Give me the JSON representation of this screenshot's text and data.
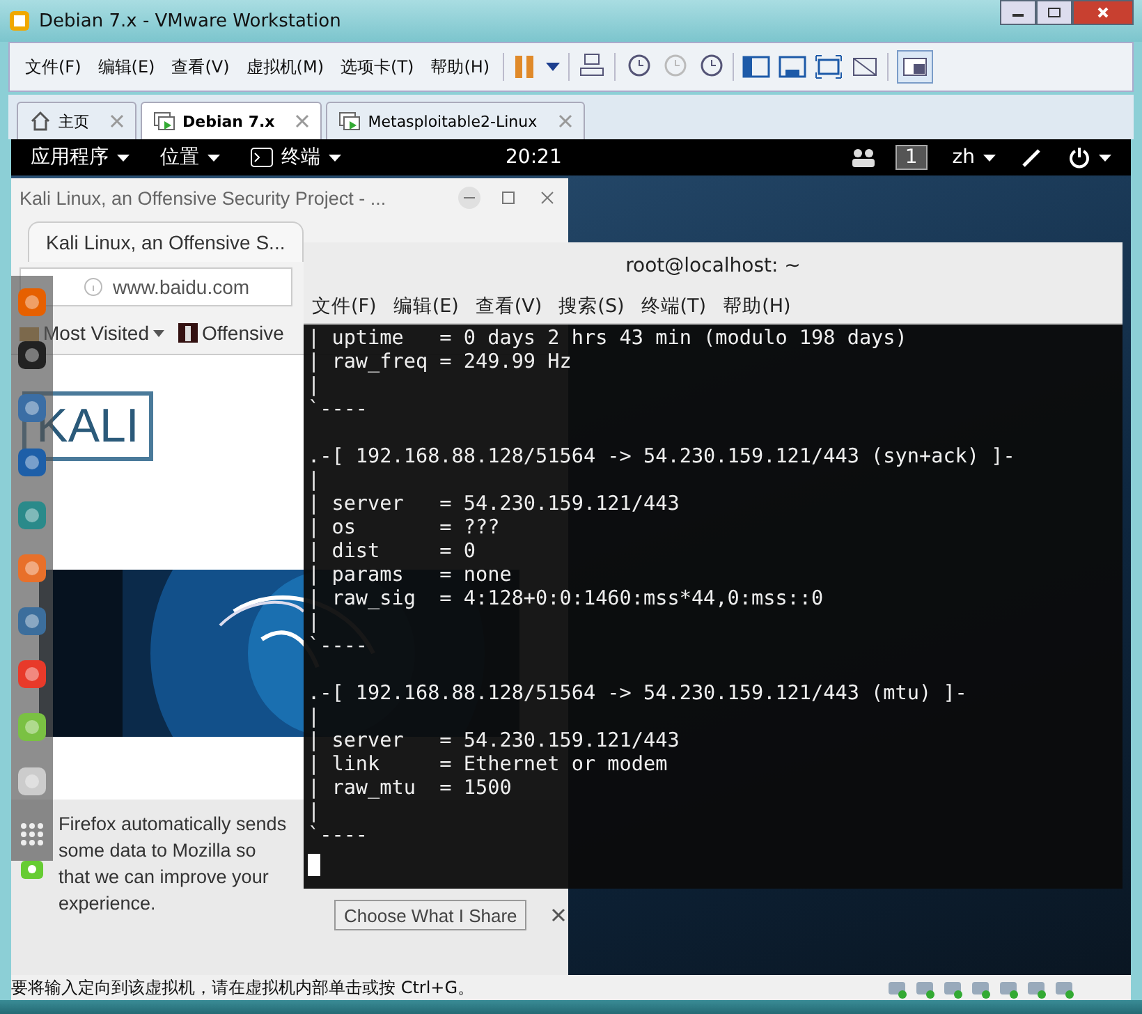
{
  "window": {
    "title": "Debian 7.x - VMware Workstation"
  },
  "menu": [
    "文件(F)",
    "编辑(E)",
    "查看(V)",
    "虚拟机(M)",
    "选项卡(T)",
    "帮助(H)"
  ],
  "tabs": [
    {
      "label": "主页",
      "selected": false,
      "kind": "home"
    },
    {
      "label": "Debian 7.x",
      "selected": true,
      "kind": "vm"
    },
    {
      "label": "Metasploitable2-Linux",
      "selected": false,
      "kind": "vm"
    }
  ],
  "guest": {
    "top_bar": {
      "menus": [
        "应用程序",
        "位置",
        "终端"
      ],
      "clock": "20:21",
      "workspace": "1",
      "input_method": "zh"
    },
    "firefox": {
      "title": "Kali Linux, an Offensive Security Project - ...",
      "tab": "Kali Linux, an Offensive S...",
      "url": "www.baidu.com",
      "bookmarks": [
        "Most Visited",
        "Offensive"
      ],
      "logo": "KALI",
      "notification": "Firefox automatically sends some data to Mozilla so that we can improve your experience.",
      "notification_button": "Choose What I Share"
    },
    "terminal": {
      "title": "root@localhost: ~",
      "menu": [
        "文件(F)",
        "编辑(E)",
        "查看(V)",
        "搜索(S)",
        "终端(T)",
        "帮助(H)"
      ],
      "lines": [
        {
          "kind": "text",
          "text": "| uptime   = 0 days 2 hrs 43 min (modulo 198 days)"
        },
        {
          "kind": "text",
          "text": "| raw_freq = 249.99 Hz"
        },
        {
          "kind": "text",
          "text": "|"
        },
        {
          "kind": "text",
          "text": "`----"
        },
        {
          "kind": "blank"
        },
        {
          "kind": "text",
          "text": ".-[ 192.168.88.128/51564 -> 54.230.159.121/443 (syn+ack) ]-"
        },
        {
          "kind": "text",
          "text": "|"
        },
        {
          "kind": "text",
          "text": "| server   = 54.230.159.121/443"
        },
        {
          "kind": "text",
          "text": "| os       = ???"
        },
        {
          "kind": "text",
          "text": "| dist     = 0"
        },
        {
          "kind": "text",
          "text": "| params   = none"
        },
        {
          "kind": "text",
          "text": "| raw_sig  = 4:128+0:0:1460:mss*44,0:mss::0"
        },
        {
          "kind": "text",
          "text": "|"
        },
        {
          "kind": "text",
          "text": "`----"
        },
        {
          "kind": "blank"
        },
        {
          "kind": "text",
          "text": ".-[ 192.168.88.128/51564 -> 54.230.159.121/443 (mtu) ]-"
        },
        {
          "kind": "text",
          "text": "|"
        },
        {
          "kind": "text",
          "text": "| server   = 54.230.159.121/443"
        },
        {
          "kind": "text",
          "text": "| link     = Ethernet or modem"
        },
        {
          "kind": "text",
          "text": "| raw_mtu  = 1500"
        },
        {
          "kind": "text",
          "text": "|"
        },
        {
          "kind": "text",
          "text": "`----"
        },
        {
          "kind": "cursor"
        }
      ]
    }
  },
  "status_bar": "要将输入定向到该虚拟机，请在虚拟机内部单击或按 Ctrl+G。"
}
